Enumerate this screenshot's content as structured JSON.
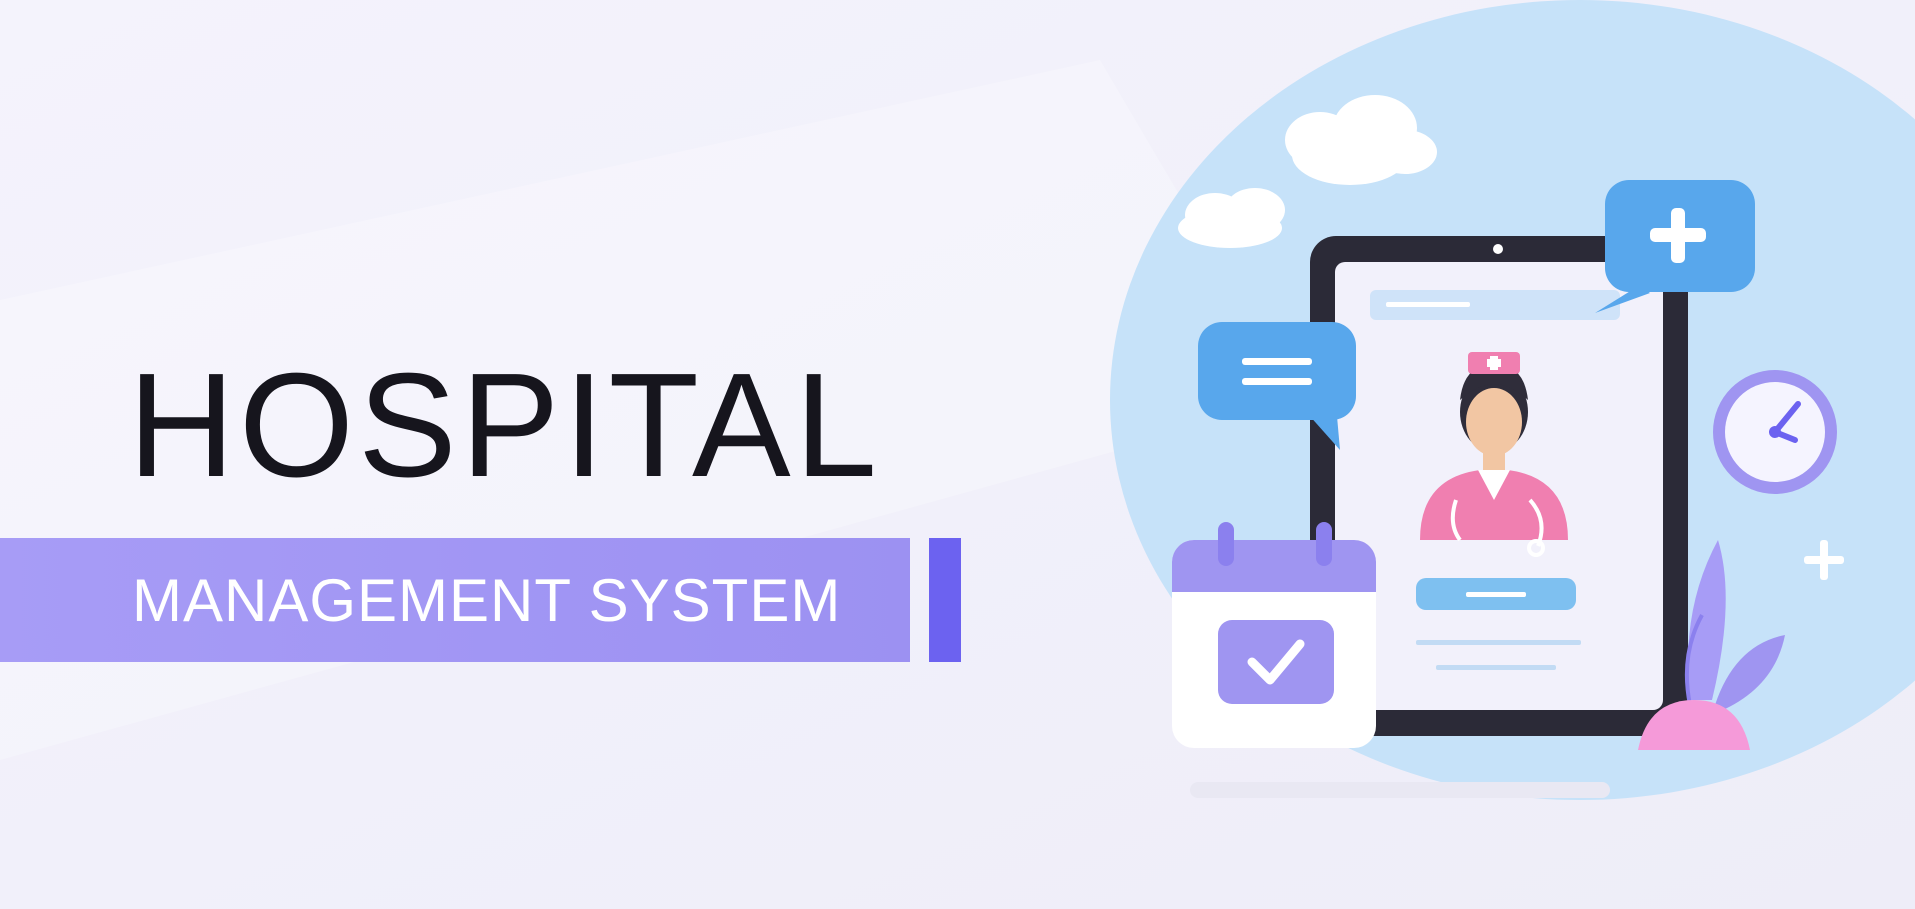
{
  "headline": {
    "title": "HOSPITAL",
    "subtitle": "MANAGEMENT SYSTEM"
  },
  "colors": {
    "background": "#f1f0fa",
    "title_text": "#16151d",
    "banner": "#9c91f2",
    "banner_accent": "#6c62f0",
    "blue_circle": "#c6e2f9",
    "bubble_blue": "#58a7ec",
    "nurse_pink": "#f07fb0",
    "calendar_purple": "#9f95f1"
  },
  "illustration": {
    "icons": [
      "cloud-icon",
      "tablet-icon",
      "nurse-avatar-icon",
      "chat-bubble-icon",
      "medical-plus-bubble-icon",
      "clock-icon",
      "calendar-check-icon",
      "plant-icon",
      "sparkle-plus-icon"
    ]
  }
}
